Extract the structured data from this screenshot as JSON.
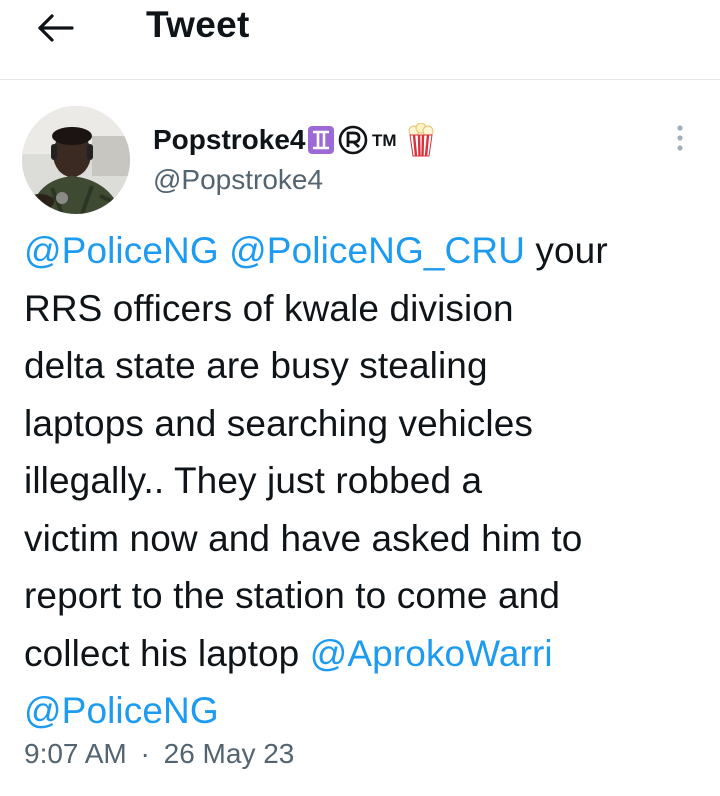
{
  "header": {
    "title": "Tweet",
    "back_icon": "arrow-left-icon"
  },
  "author": {
    "display_name": "Popstroke4",
    "badges": [
      "gemini-symbol-icon",
      "registered-icon",
      "trademark-icon",
      "popcorn-icon"
    ],
    "badge_text": {
      "tm": "TM"
    },
    "handle": "@Popstroke4"
  },
  "tweet": {
    "lines": [
      [
        {
          "text": "@PoliceNG",
          "mention": true
        },
        {
          "text": " ",
          "mention": false
        },
        {
          "text": "@PoliceNG_CRU",
          "mention": true
        },
        {
          "text": " your",
          "mention": false
        }
      ],
      [
        {
          "text": "RRS officers of kwale division",
          "mention": false
        }
      ],
      [
        {
          "text": "delta state are busy stealing",
          "mention": false
        }
      ],
      [
        {
          "text": "laptops and searching vehicles",
          "mention": false
        }
      ],
      [
        {
          "text": "illegally.. They just robbed a",
          "mention": false
        }
      ],
      [
        {
          "text": "victim now and have asked him to",
          "mention": false
        }
      ],
      [
        {
          "text": "report to the station to come and",
          "mention": false
        }
      ],
      [
        {
          "text": "collect his laptop ",
          "mention": false
        },
        {
          "text": "@AprokoWarri",
          "mention": true
        }
      ],
      [
        {
          "text": "@PoliceNG",
          "mention": true
        }
      ]
    ],
    "time": "9:07 AM",
    "separator": "·",
    "date": "26 May 23"
  },
  "colors": {
    "mention": "#1d9bf0",
    "secondary_text": "#536471",
    "primary_text": "#0f1419",
    "divider": "#e6e9ec"
  },
  "menu": {
    "icon": "more-vertical-icon"
  }
}
